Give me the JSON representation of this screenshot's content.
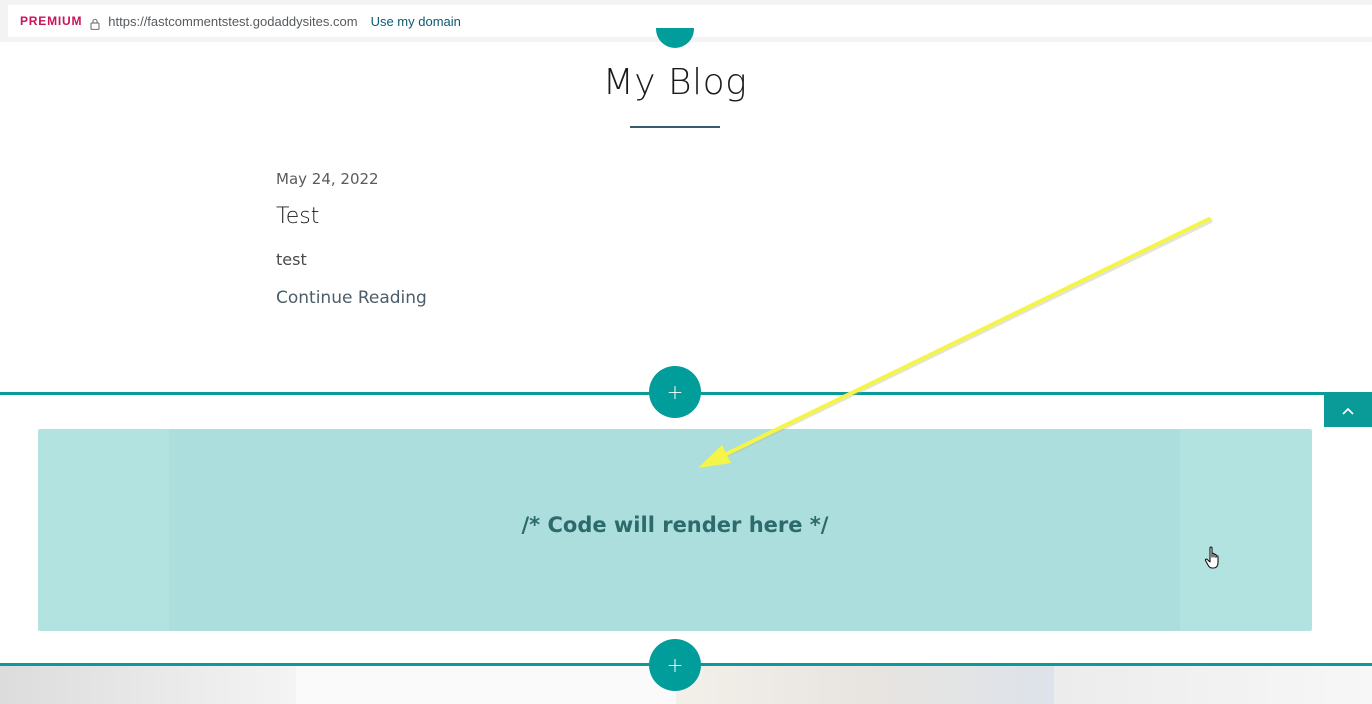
{
  "browser": {
    "premium_label": "PREMIUM",
    "url": "https://fastcommentstest.godaddysites.com",
    "domain_link": "Use my domain"
  },
  "blog": {
    "title": "My Blog",
    "posts": [
      {
        "date": "May 24, 2022",
        "title": "Test",
        "excerpt": "test",
        "continue_label": "Continue Reading"
      }
    ]
  },
  "editor": {
    "add_section_symbol": "+",
    "code_placeholder": "/* Code will render here */"
  },
  "colors": {
    "accent": "#009d9b",
    "premium": "#c8125a",
    "code_block_bg": "#b2e3e1",
    "annotation_arrow": "#f4f548"
  },
  "icons": {
    "lock": "lock-icon",
    "scroll_top": "chevron-up-icon",
    "cursor": "hand-pointer-icon",
    "annotation": "arrow-annotation-icon"
  }
}
